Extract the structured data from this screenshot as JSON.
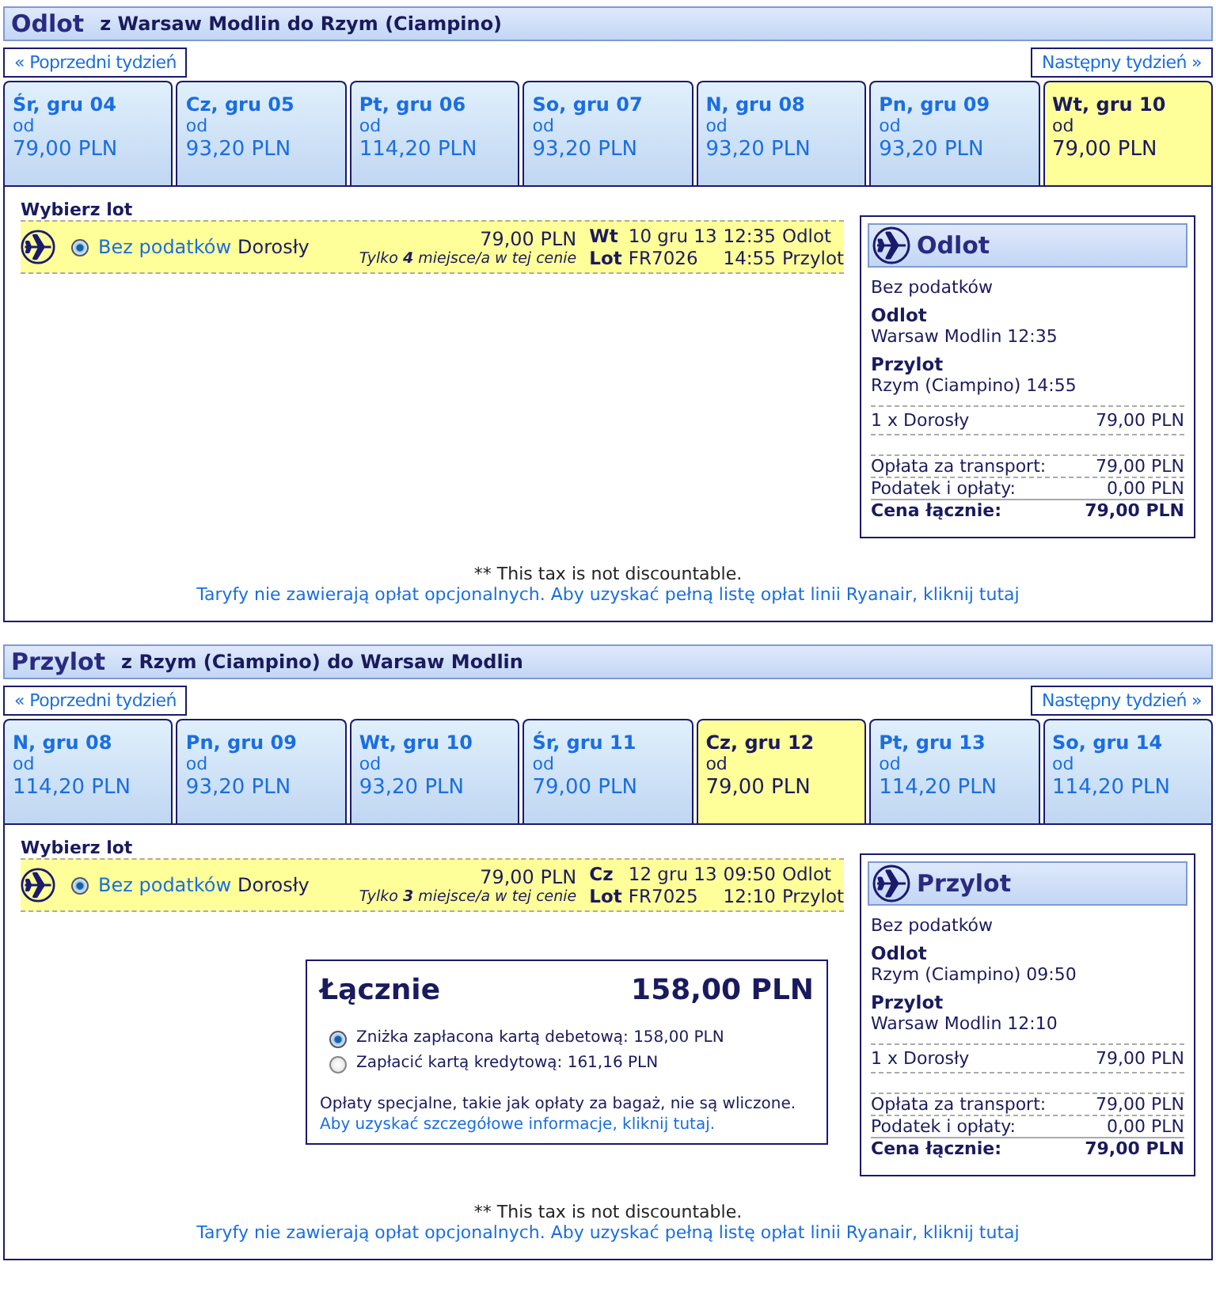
{
  "sections": [
    {
      "title": "Odlot",
      "route": "z Warsaw Modlin do Rzym (Ciampino)",
      "prev_week": "« Poprzedni tydzień",
      "next_week": "Następny tydzień »",
      "days": [
        {
          "day": "Śr, gru 04",
          "from": "od",
          "price": "79,00 PLN",
          "selected": false
        },
        {
          "day": "Cz, gru 05",
          "from": "od",
          "price": "93,20 PLN",
          "selected": false
        },
        {
          "day": "Pt, gru 06",
          "from": "od",
          "price": "114,20 PLN",
          "selected": false
        },
        {
          "day": "So, gru 07",
          "from": "od",
          "price": "93,20 PLN",
          "selected": false
        },
        {
          "day": "N, gru 08",
          "from": "od",
          "price": "93,20 PLN",
          "selected": false
        },
        {
          "day": "Pn, gru 09",
          "from": "od",
          "price": "93,20 PLN",
          "selected": false
        },
        {
          "day": "Wt, gru 10",
          "from": "od",
          "price": "79,00 PLN",
          "selected": true
        }
      ],
      "choose_label": "Wybierz lot",
      "fare": {
        "selected": true,
        "fare_type": "Bez podatków",
        "passenger": "Dorosły",
        "price": "79,00 PLN",
        "seats_note": "Tylko **4** miejsce/a w tej cenie",
        "day_label": "Wt",
        "date": "10 gru 13",
        "dep_time": "12:35",
        "dep_label": "Odlot",
        "flight_label": "Lot",
        "flight_no": "FR7026",
        "arr_time": "14:55",
        "arr_label": "Przylot"
      },
      "summary": {
        "title": "Odlot",
        "fare_type": "Bez podatków",
        "dep_label": "Odlot",
        "dep_value": "Warsaw Modlin 12:35",
        "arr_label": "Przylot",
        "arr_value": "Rzym (Ciampino) 14:55",
        "pax_label": "1 x Dorosły",
        "pax_price": "79,00 PLN",
        "transport_label": "Opłata za transport:",
        "transport_value": "79,00 PLN",
        "tax_label": "Podatek i opłaty:",
        "tax_value": "0,00 PLN",
        "total_label": "Cena łącznie:",
        "total_value": "79,00 PLN"
      },
      "tax_note": "** This tax is not discountable.",
      "fares_link": "Taryfy nie zawierają opłat opcjonalnych. Aby uzyskać pełną listę opłat linii Ryanair, kliknij tutaj"
    },
    {
      "title": "Przylot",
      "route": "z Rzym (Ciampino) do Warsaw Modlin",
      "prev_week": "« Poprzedni tydzień",
      "next_week": "Następny tydzień »",
      "days": [
        {
          "day": "N, gru 08",
          "from": "od",
          "price": "114,20 PLN",
          "selected": false
        },
        {
          "day": "Pn, gru 09",
          "from": "od",
          "price": "93,20 PLN",
          "selected": false
        },
        {
          "day": "Wt, gru 10",
          "from": "od",
          "price": "93,20 PLN",
          "selected": false
        },
        {
          "day": "Śr, gru 11",
          "from": "od",
          "price": "79,00 PLN",
          "selected": false
        },
        {
          "day": "Cz, gru 12",
          "from": "od",
          "price": "79,00 PLN",
          "selected": true
        },
        {
          "day": "Pt, gru 13",
          "from": "od",
          "price": "114,20 PLN",
          "selected": false
        },
        {
          "day": "So, gru 14",
          "from": "od",
          "price": "114,20 PLN",
          "selected": false
        }
      ],
      "choose_label": "Wybierz lot",
      "fare": {
        "selected": true,
        "fare_type": "Bez podatków",
        "passenger": "Dorosły",
        "price": "79,00 PLN",
        "seats_note": "Tylko **3** miejsce/a w tej cenie",
        "day_label": "Cz",
        "date": "12 gru 13",
        "dep_time": "09:50",
        "dep_label": "Odlot",
        "flight_label": "Lot",
        "flight_no": "FR7025",
        "arr_time": "12:10",
        "arr_label": "Przylot"
      },
      "summary": {
        "title": "Przylot",
        "fare_type": "Bez podatków",
        "dep_label": "Odlot",
        "dep_value": "Rzym (Ciampino) 09:50",
        "arr_label": "Przylot",
        "arr_value": "Warsaw Modlin 12:10",
        "pax_label": "1 x Dorosły",
        "pax_price": "79,00 PLN",
        "transport_label": "Opłata za transport:",
        "transport_value": "79,00 PLN",
        "tax_label": "Podatek i opłaty:",
        "tax_value": "0,00 PLN",
        "total_label": "Cena łącznie:",
        "total_value": "79,00 PLN"
      },
      "total": {
        "title": "Łącznie",
        "amount": "158,00 PLN",
        "options": [
          {
            "label": "Zniżka zapłacona kartą debetową: 158,00 PLN",
            "selected": true
          },
          {
            "label": "Zapłacić kartą kredytową: 161,16 PLN",
            "selected": false
          }
        ],
        "note": "Opłaty specjalne, takie jak opłaty za bagaż, nie są wliczone.",
        "note_link": "Aby uzyskać szczegółowe informacje, kliknij tutaj."
      },
      "tax_note": "** This tax is not discountable.",
      "fares_link": "Taryfy nie zawierają opłat opcjonalnych. Aby uzyskać pełną listę opłat linii Ryanair, kliknij tutaj"
    }
  ]
}
